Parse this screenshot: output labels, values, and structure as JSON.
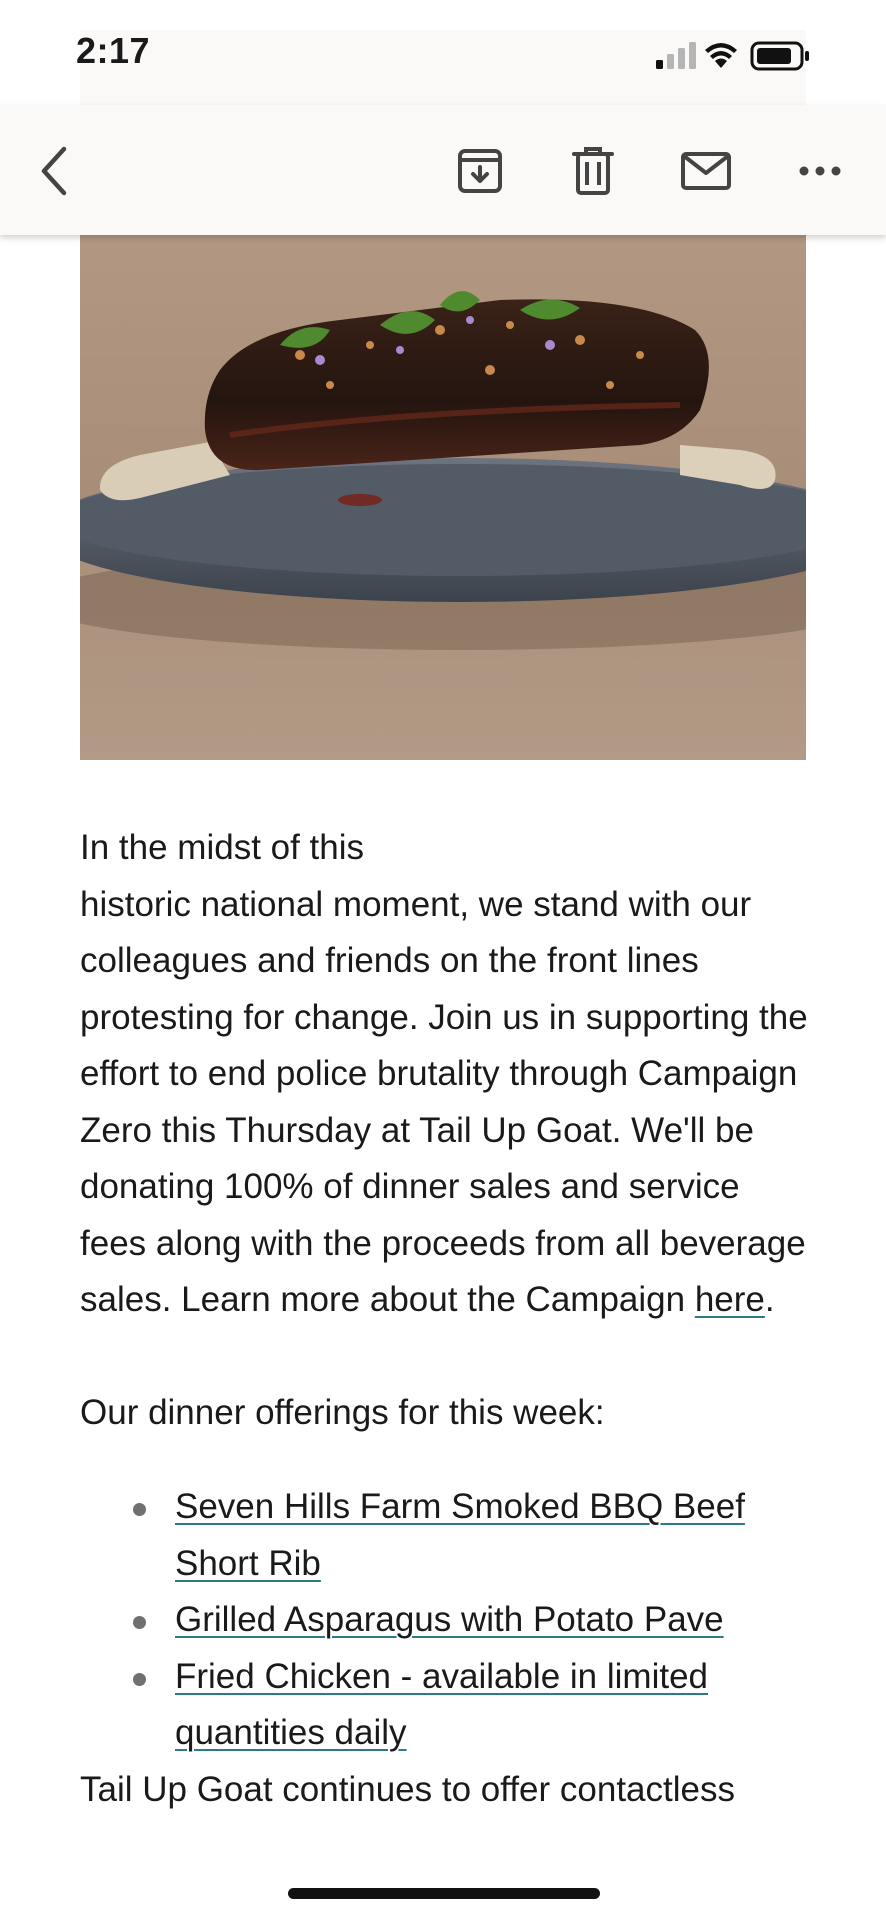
{
  "status_bar": {
    "time": "2:17"
  },
  "toolbar": {
    "icons": [
      "back-chevron-icon",
      "archive-icon",
      "trash-icon",
      "mail-icon",
      "more-icon"
    ]
  },
  "email": {
    "paragraph_lines": [
      "In the midst of this",
      "historic national moment, we stand with our colleagues and friends on the front lines protesting for change. Join us in supporting the effort to end police brutality through Campaign Zero this Thursday at Tail Up Goat. We'll be donating 100% of dinner sales and service fees along with the proceeds from all beverage sales. Learn more about the Campaign "
    ],
    "here_link": "here",
    "period": ".",
    "offerings_heading": "Our dinner offerings for this week:",
    "dishes": [
      "Seven Hills Farm Smoked BBQ Beef Short Rib",
      "Grilled Asparagus with Potato Pave",
      "Fried Chicken - available in limited quantities daily"
    ],
    "footer_text": "Tail Up Goat continues to offer contactless"
  },
  "colors": {
    "link_underline": "#2c7a86",
    "toolbar_bg": "#faf9f8",
    "hero_bg": "#b39a86"
  }
}
